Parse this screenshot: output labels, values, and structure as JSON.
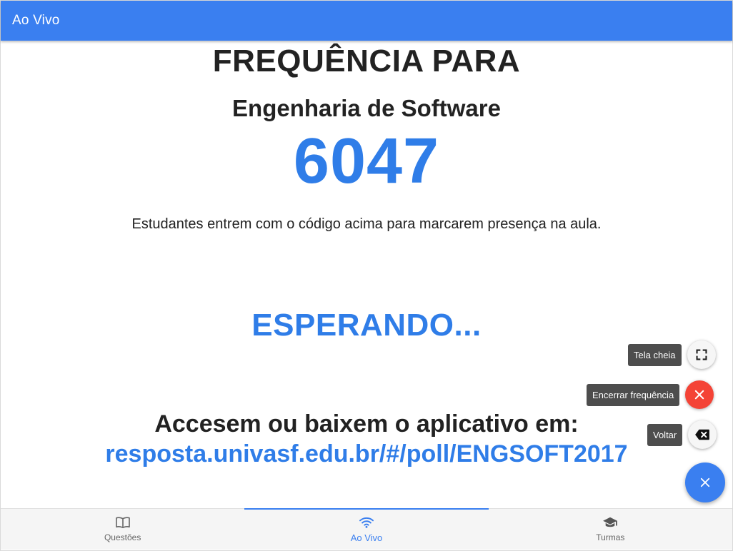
{
  "app_bar": {
    "title": "Ao Vivo"
  },
  "main": {
    "heading": "FREQUÊNCIA PARA",
    "course": "Engenharia de Software",
    "code": "6047",
    "instruction": "Estudantes entrem com o código acima para marcarem presença na aula.",
    "status": "ESPERANDO...",
    "access_text": "Accesem ou baixem o aplicativo em:",
    "url": "resposta.univasf.edu.br/#/poll/ENGSOFT2017"
  },
  "fab_menu": {
    "actions": [
      {
        "tooltip": "Tela cheia",
        "icon": "fullscreen-icon"
      },
      {
        "tooltip": "Encerrar frequência",
        "icon": "close-icon"
      },
      {
        "tooltip": "Voltar",
        "icon": "backspace-icon"
      }
    ],
    "main_icon": "close-icon"
  },
  "bottom_nav": {
    "items": [
      {
        "label": "Questões",
        "icon": "book-icon",
        "active": false
      },
      {
        "label": "Ao Vivo",
        "icon": "wifi-icon",
        "active": true
      },
      {
        "label": "Turmas",
        "icon": "school-icon",
        "active": false
      }
    ]
  },
  "colors": {
    "primary": "#3a7ff0",
    "accent_text": "#2f7de8",
    "danger": "#f44336"
  }
}
